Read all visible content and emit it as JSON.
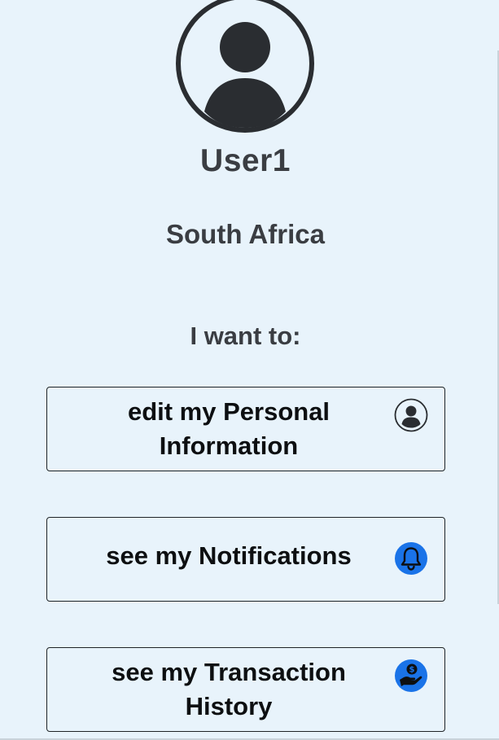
{
  "profile": {
    "username": "User1",
    "country": "South Africa"
  },
  "prompt": "I want to:",
  "actions": [
    {
      "label_line1": "edit my Personal",
      "label_line2": "Information",
      "icon": "user-circle-icon"
    },
    {
      "label_line1": "see my Notifications",
      "label_line2": "",
      "icon": "bell-icon"
    },
    {
      "label_line1": "see my Transaction",
      "label_line2": "History",
      "icon": "money-hand-icon"
    }
  ],
  "colors": {
    "background": "#e8f3fb",
    "text": "#3a3d42",
    "accent_blue": "#1a73e8",
    "icon_dark": "#2a2d31"
  }
}
